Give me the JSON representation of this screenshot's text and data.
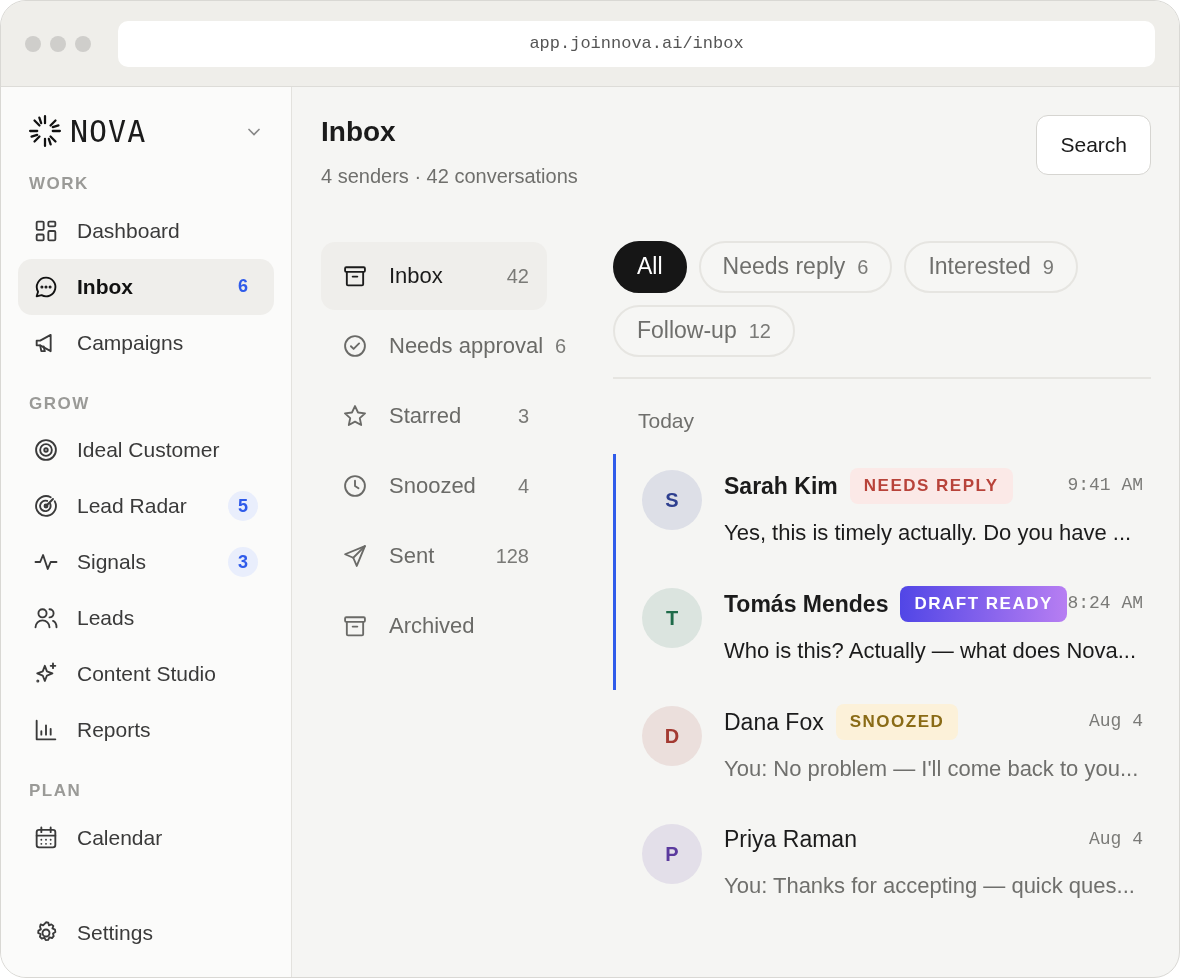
{
  "browser": {
    "url": "app.joinnova.ai/inbox"
  },
  "brand": {
    "name": "NOVA"
  },
  "sidebar": {
    "sections": [
      {
        "label": "WORK",
        "items": [
          {
            "label": "Dashboard",
            "selected": false
          },
          {
            "label": "Inbox",
            "selected": true,
            "badge": "6"
          },
          {
            "label": "Campaigns",
            "selected": false
          }
        ]
      },
      {
        "label": "GROW",
        "items": [
          {
            "label": "Ideal Customer",
            "selected": false
          },
          {
            "label": "Lead Radar",
            "selected": false,
            "badge": "5"
          },
          {
            "label": "Signals",
            "selected": false,
            "badge": "3"
          },
          {
            "label": "Leads",
            "selected": false
          },
          {
            "label": "Content Studio",
            "selected": false
          },
          {
            "label": "Reports",
            "selected": false
          }
        ]
      },
      {
        "label": "PLAN",
        "items": [
          {
            "label": "Calendar",
            "selected": false
          }
        ]
      }
    ],
    "footer": {
      "label": "Settings"
    }
  },
  "header": {
    "title": "Inbox",
    "subtitle": "4 senders · 42 conversations",
    "search_button": "Search"
  },
  "folders": [
    {
      "label": "Inbox",
      "count": "42",
      "selected": true
    },
    {
      "label": "Needs approval",
      "count": "6",
      "selected": false
    },
    {
      "label": "Starred",
      "count": "3",
      "selected": false
    },
    {
      "label": "Snoozed",
      "count": "4",
      "selected": false
    },
    {
      "label": "Sent",
      "count": "128",
      "selected": false
    },
    {
      "label": "Archived",
      "selected": false
    }
  ],
  "filters": [
    {
      "label": "All",
      "selected": true
    },
    {
      "label": "Needs reply",
      "count": "6",
      "selected": false
    },
    {
      "label": "Interested",
      "count": "9",
      "selected": false
    },
    {
      "label": "Follow-up",
      "count": "12",
      "selected": false
    }
  ],
  "conversations": {
    "group": "Today",
    "items": [
      {
        "initial": "S",
        "color": "#2e3f8f",
        "name": "Sarah Kim",
        "tag": {
          "kind": "needs_reply",
          "label": "NEEDS REPLY"
        },
        "time": "9:41 AM",
        "preview": "Yes, this is timely actually. Do you have ...",
        "unread": true
      },
      {
        "initial": "T",
        "color": "#1f6b4a",
        "name": "Tomás Mendes",
        "tag": {
          "kind": "draft_ready",
          "label": "DRAFT READY"
        },
        "time": "8:24 AM",
        "preview": "Who is this? Actually — what does Nova...",
        "unread": true
      },
      {
        "initial": "D",
        "color": "#a33a32",
        "name": "Dana Fox",
        "tag": {
          "kind": "snoozed",
          "label": "SNOOZED"
        },
        "time": "Aug 4",
        "preview": "You: No problem — I'll come back to you...",
        "unread": false
      },
      {
        "initial": "P",
        "color": "#5b3a9e",
        "name": "Priya Raman",
        "time": "Aug 4",
        "preview": "You: Thanks for accepting — quick ques...",
        "unread": false
      }
    ]
  }
}
